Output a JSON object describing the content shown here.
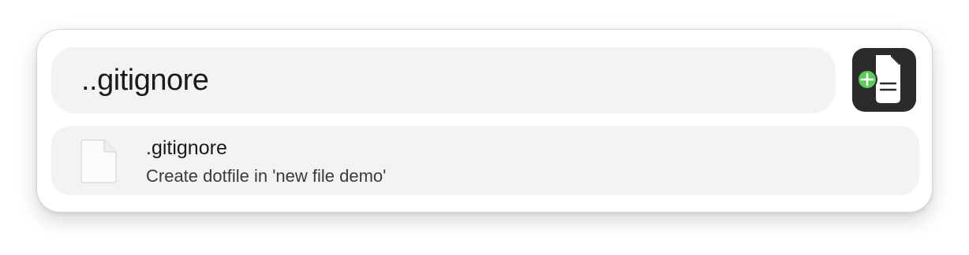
{
  "search": {
    "value": "..gitignore",
    "placeholder": ""
  },
  "app": {
    "icon": "new-file-icon"
  },
  "results": [
    {
      "icon": "document-icon",
      "title": ".gitignore",
      "subtitle": "Create dotfile in 'new file demo'"
    }
  ],
  "colors": {
    "panel_background": "#ffffff",
    "field_background": "#f3f3f3",
    "app_icon_background": "#2b2b2b",
    "add_badge": "#5cc95a"
  }
}
